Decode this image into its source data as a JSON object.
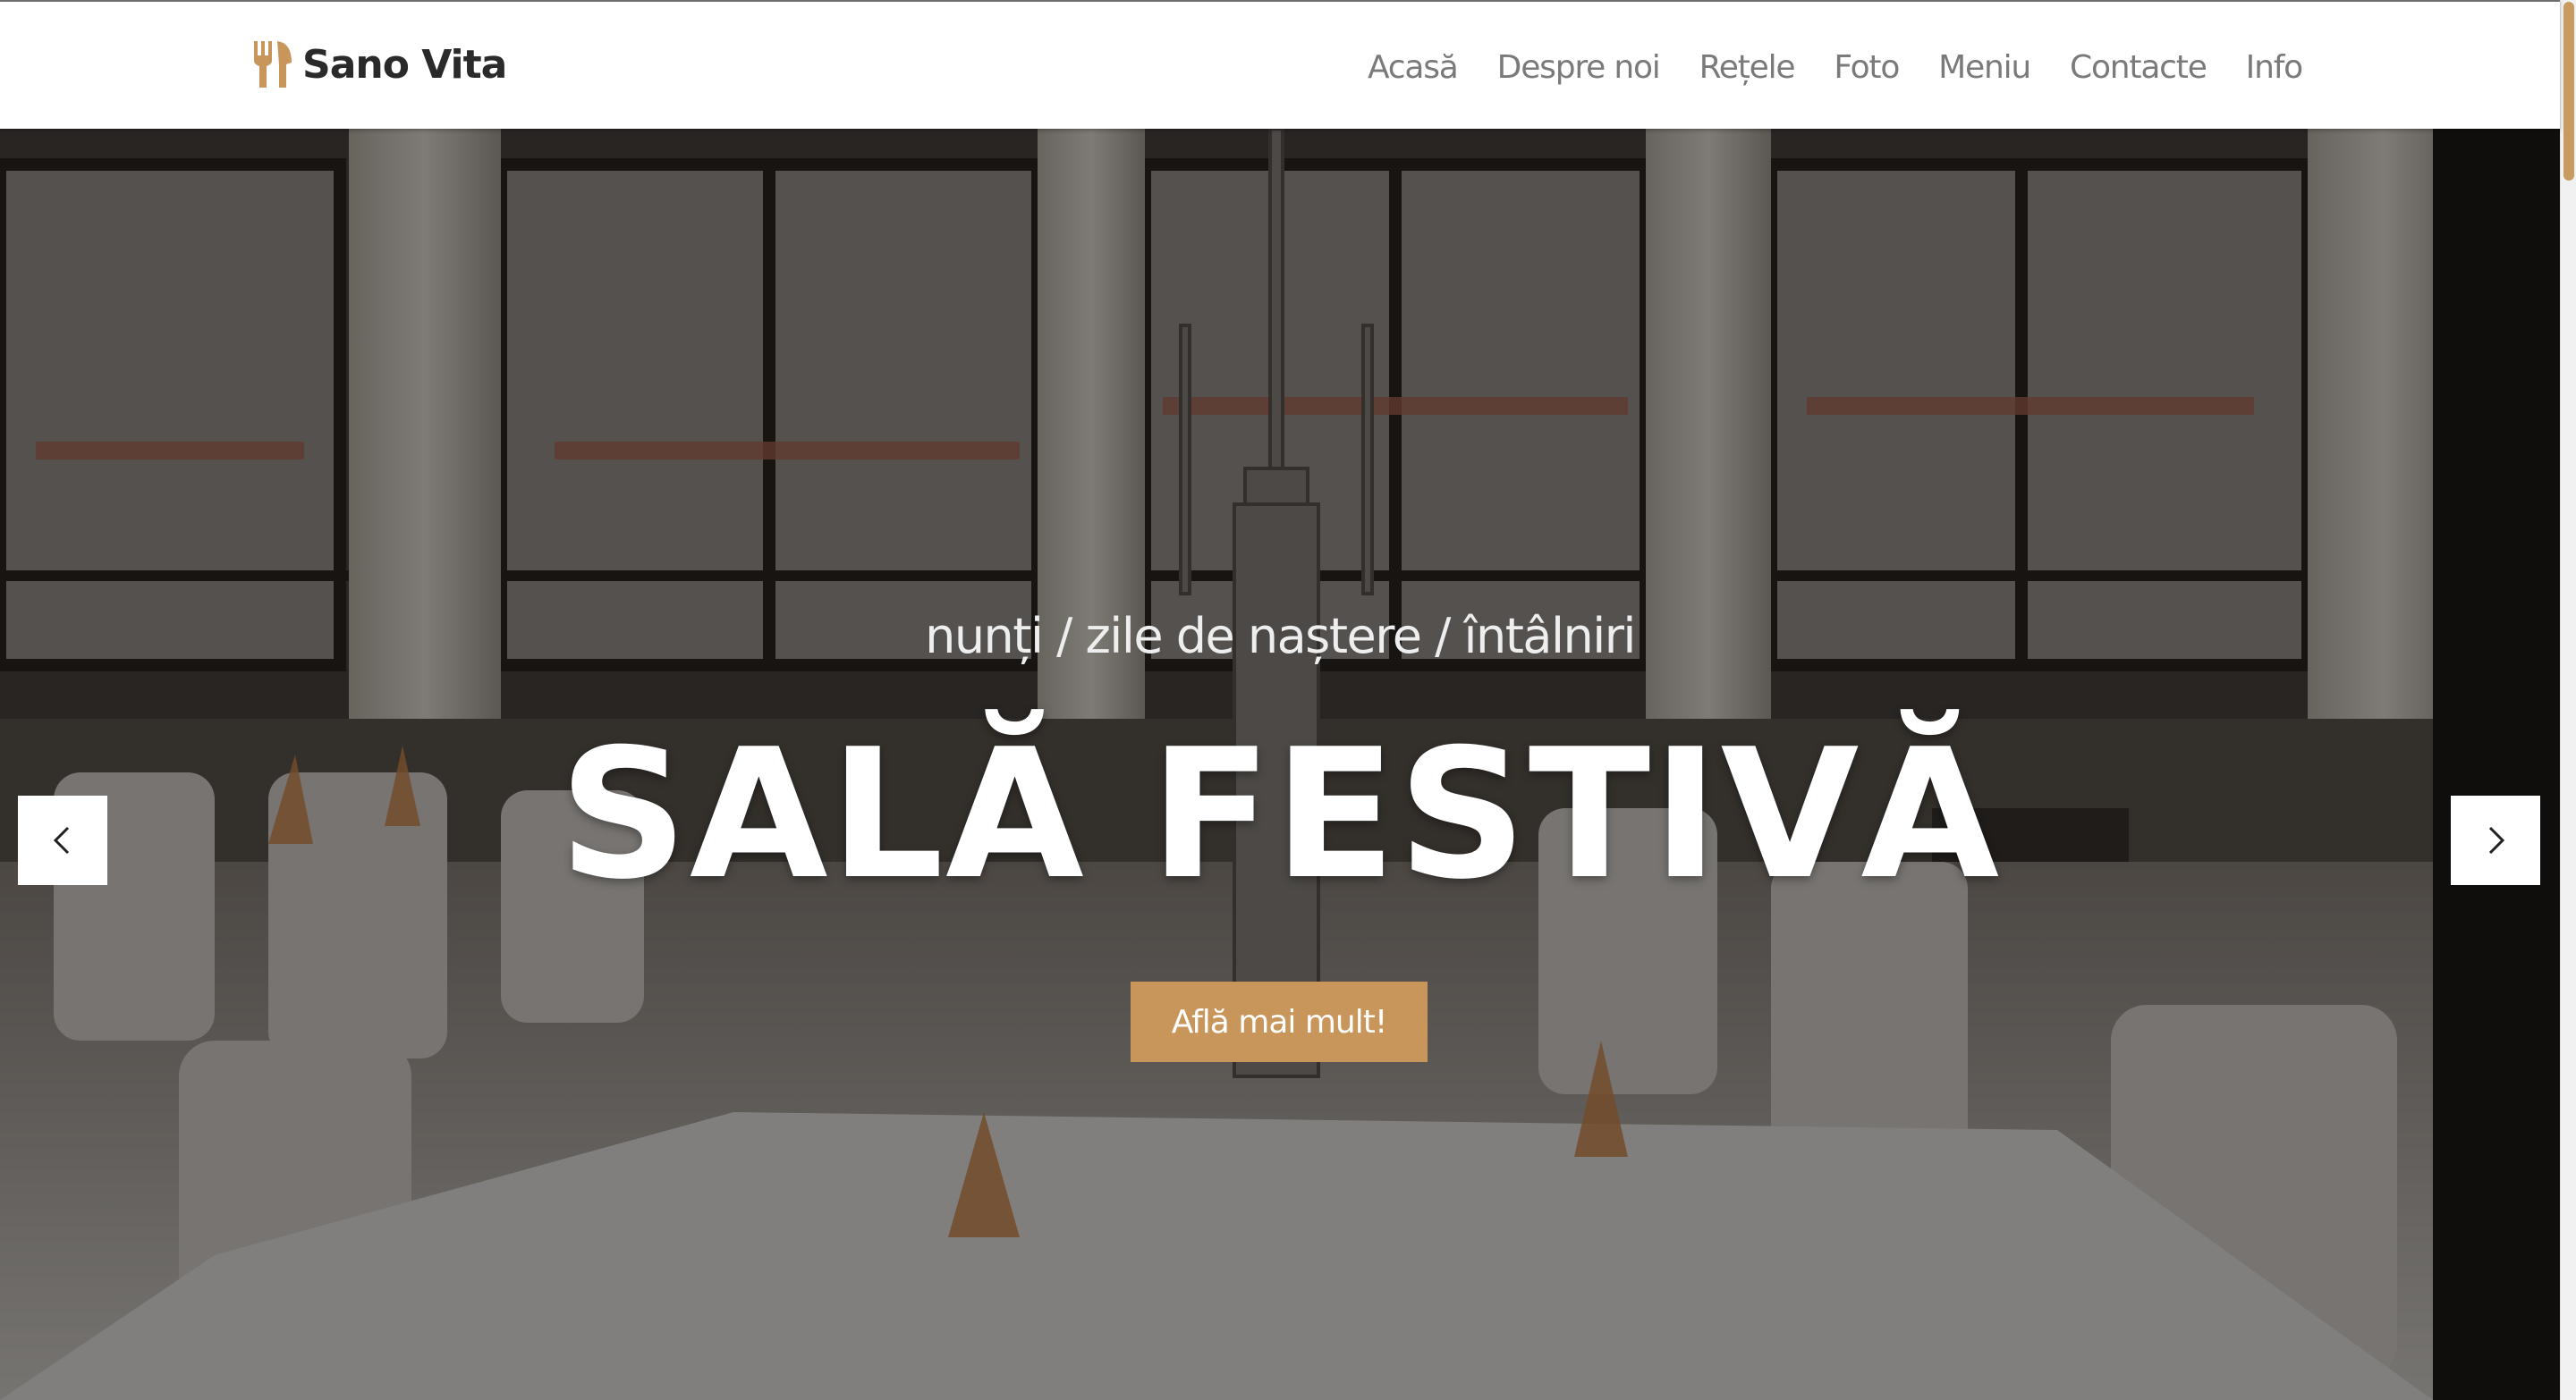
{
  "header": {
    "brand_name": "Sano Vita",
    "brand_icon": "fork-knife-icon",
    "brand_color": "#c8955a",
    "nav": [
      {
        "label": "Acasă"
      },
      {
        "label": "Despre noi"
      },
      {
        "label": "Rețele"
      },
      {
        "label": "Foto"
      },
      {
        "label": "Meniu"
      },
      {
        "label": "Contacte"
      },
      {
        "label": "Info"
      }
    ]
  },
  "hero": {
    "subtitle": "nunți / zile de naștere / întâlniri",
    "title": "SALĂ FESTIVĂ",
    "cta_label": "Află mai mult!",
    "cta_color": "#c8955a",
    "prev_icon": "chevron-left-icon",
    "next_icon": "chevron-right-icon"
  }
}
